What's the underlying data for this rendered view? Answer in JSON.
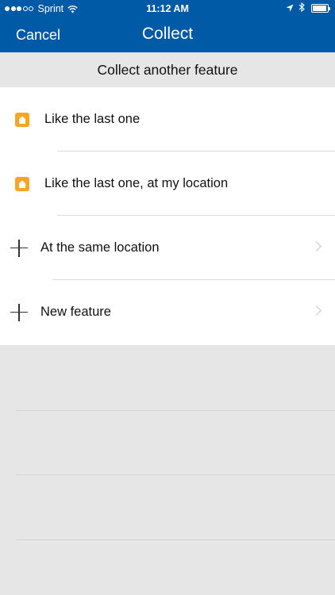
{
  "status": {
    "carrier": "Sprint",
    "time": "11:12 AM",
    "signal_bars_filled": 3,
    "signal_bars_total": 5
  },
  "nav": {
    "cancel_label": "Cancel",
    "title": "Collect"
  },
  "section_header": "Collect another feature",
  "items": [
    {
      "label": "Like the last one",
      "icon": "feature-template-icon",
      "chevron": false
    },
    {
      "label": "Like the last one, at my location",
      "icon": "feature-template-icon",
      "chevron": false
    },
    {
      "label": "At the same location",
      "icon": "plus-icon",
      "chevron": true
    },
    {
      "label": "New feature",
      "icon": "plus-icon",
      "chevron": true
    }
  ],
  "colors": {
    "nav_background": "#005aa5",
    "icon_accent": "#f5a623",
    "page_background": "#e6e6e6"
  }
}
